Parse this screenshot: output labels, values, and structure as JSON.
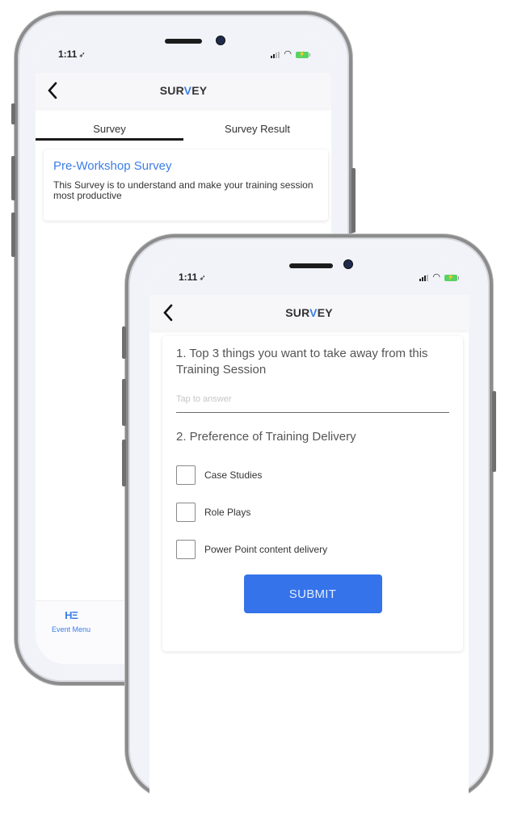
{
  "back_phone": {
    "status_bar": {
      "time": "1:11",
      "location_icon": "location-arrow-icon",
      "icons": [
        "signal-icon",
        "wifi-icon",
        "battery-charging-icon"
      ]
    },
    "nav": {
      "back_icon": "chevron-left-icon",
      "title_pre": "SUR",
      "title_accent": "V",
      "title_post": "EY"
    },
    "tabs": [
      {
        "label": "Survey",
        "active": true
      },
      {
        "label": "Survey Result",
        "active": false
      }
    ],
    "survey_card": {
      "title": "Pre-Workshop Survey",
      "description": "This Survey is to understand and make your training session most productive"
    },
    "bottom_nav": {
      "icon": "HΞ",
      "label": "Event Menu"
    }
  },
  "front_phone": {
    "status_bar": {
      "time": "1:11",
      "location_icon": "location-arrow-icon",
      "icons": [
        "signal-icon",
        "wifi-icon",
        "battery-charging-icon"
      ]
    },
    "nav": {
      "back_icon": "chevron-left-icon",
      "title_pre": "SUR",
      "title_accent": "V",
      "title_post": "EY"
    },
    "form": {
      "question1": "1. Top 3 things you want to take away from this Training Session",
      "answer_placeholder": "Tap to answer",
      "answer_value": "",
      "question2": "2. Preference of Training Delivery",
      "options": [
        {
          "label": "Case Studies",
          "checked": false
        },
        {
          "label": "Role Plays",
          "checked": false
        },
        {
          "label": "Power Point content delivery",
          "checked": false
        }
      ],
      "submit_label": "SUBMIT"
    }
  },
  "colors": {
    "accent": "#3b7de8",
    "submit": "#3573ea",
    "frame": "#8c8c8c",
    "screen_bg": "#f1f3f9"
  }
}
